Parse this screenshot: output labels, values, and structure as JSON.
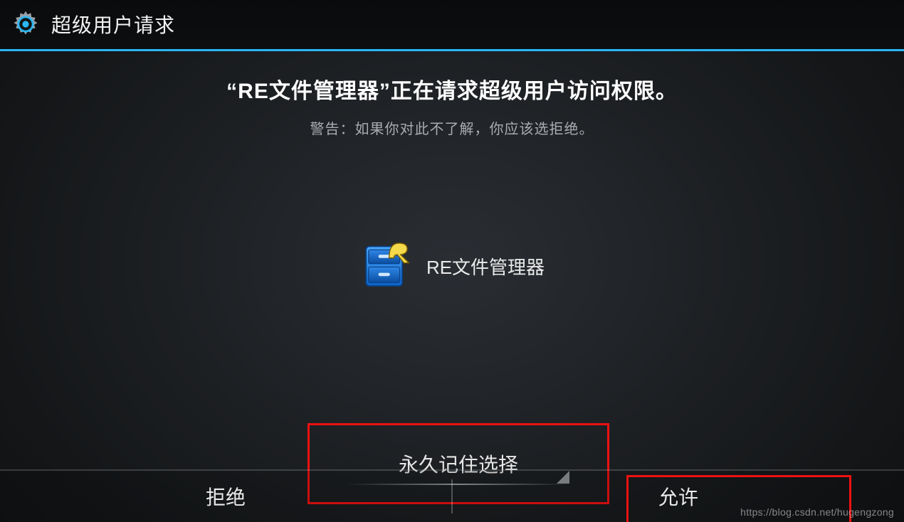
{
  "header": {
    "title": "超级用户请求"
  },
  "main": {
    "request_prefix": "“",
    "request_app": "RE文件管理器",
    "request_suffix": "”正在请求超级用户访问权限。",
    "warning": "警告：如果你对此不了解，你应该选拒绝。"
  },
  "app": {
    "name": "RE文件管理器"
  },
  "remember": {
    "label": "永久记住选择"
  },
  "footer": {
    "deny": "拒绝",
    "allow": "允许"
  },
  "watermark": "https://blog.csdn.net/hugengzong",
  "colors": {
    "accent": "#29b6f6",
    "highlight": "#ee1111"
  }
}
